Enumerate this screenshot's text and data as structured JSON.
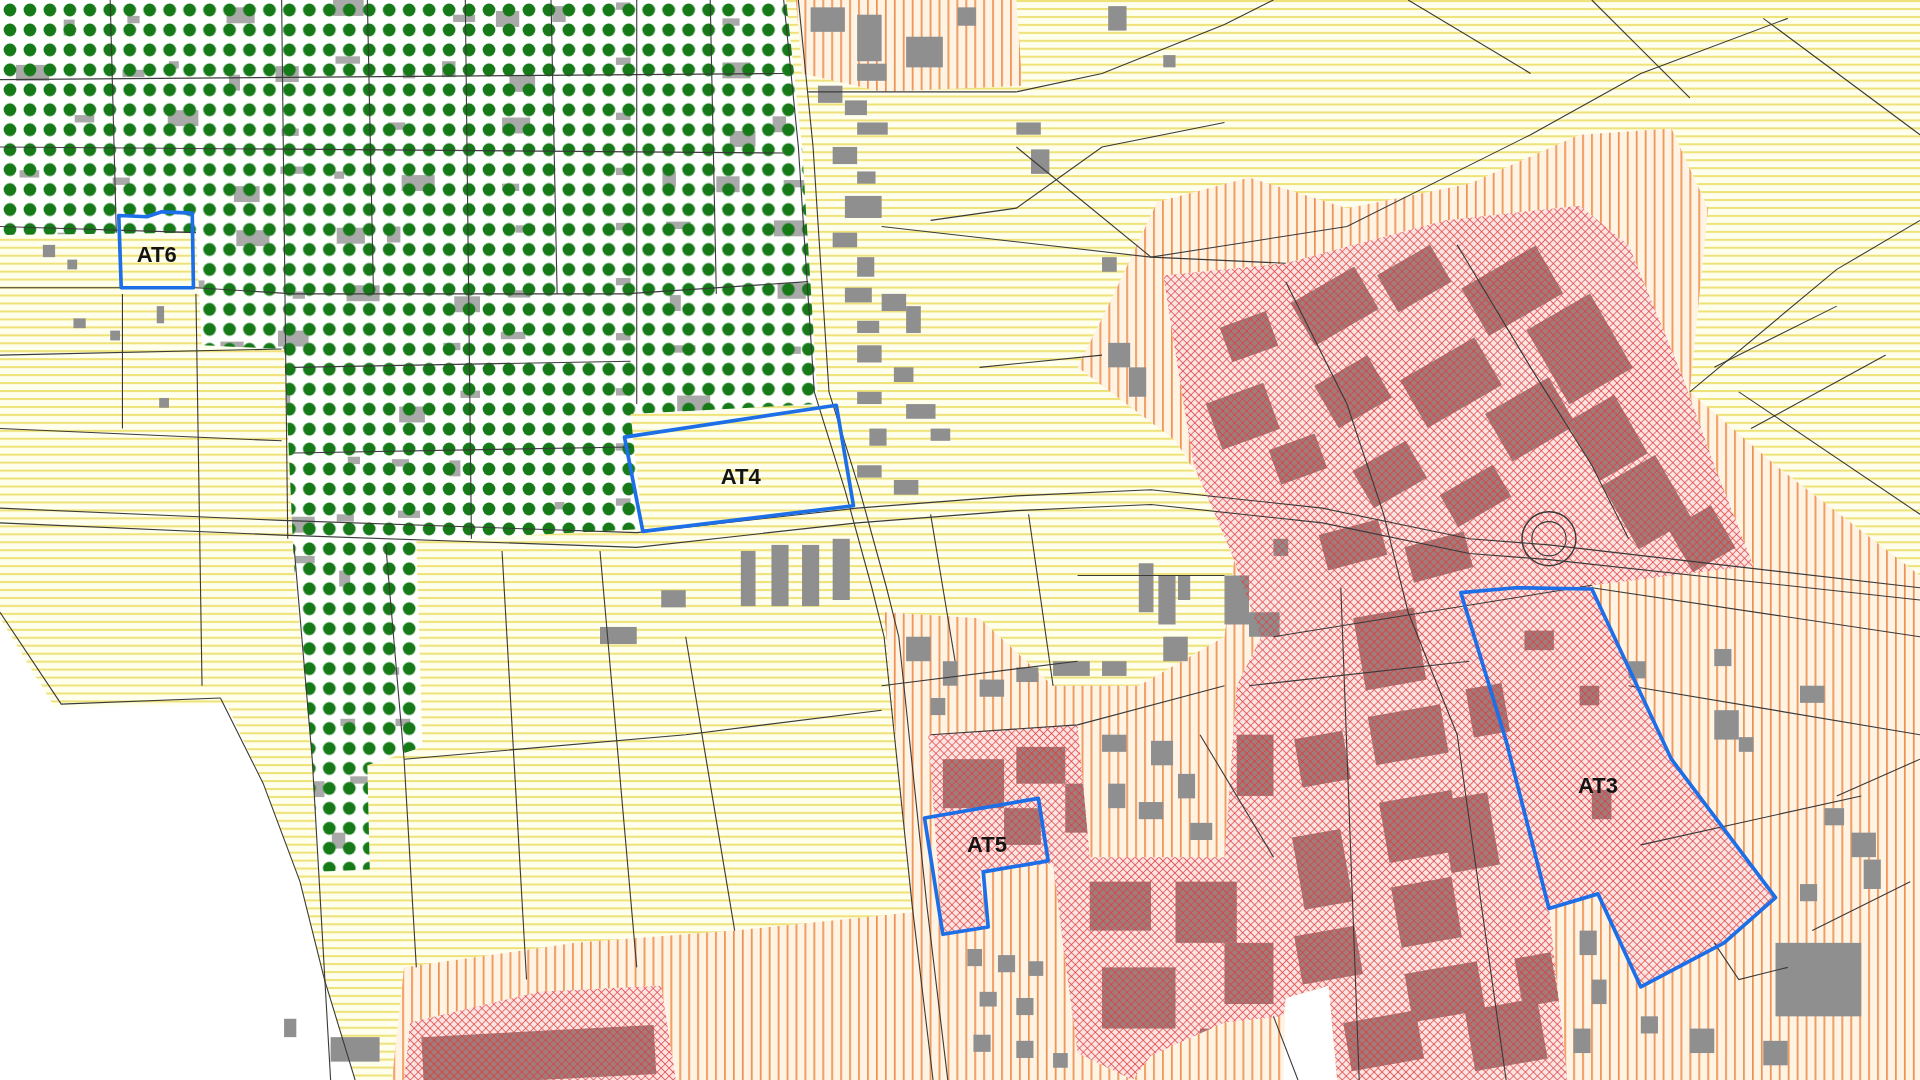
{
  "map": {
    "areas": [
      {
        "label": "AT6"
      },
      {
        "label": "AT4"
      },
      {
        "label": "AT5"
      },
      {
        "label": "AT3"
      }
    ]
  }
}
